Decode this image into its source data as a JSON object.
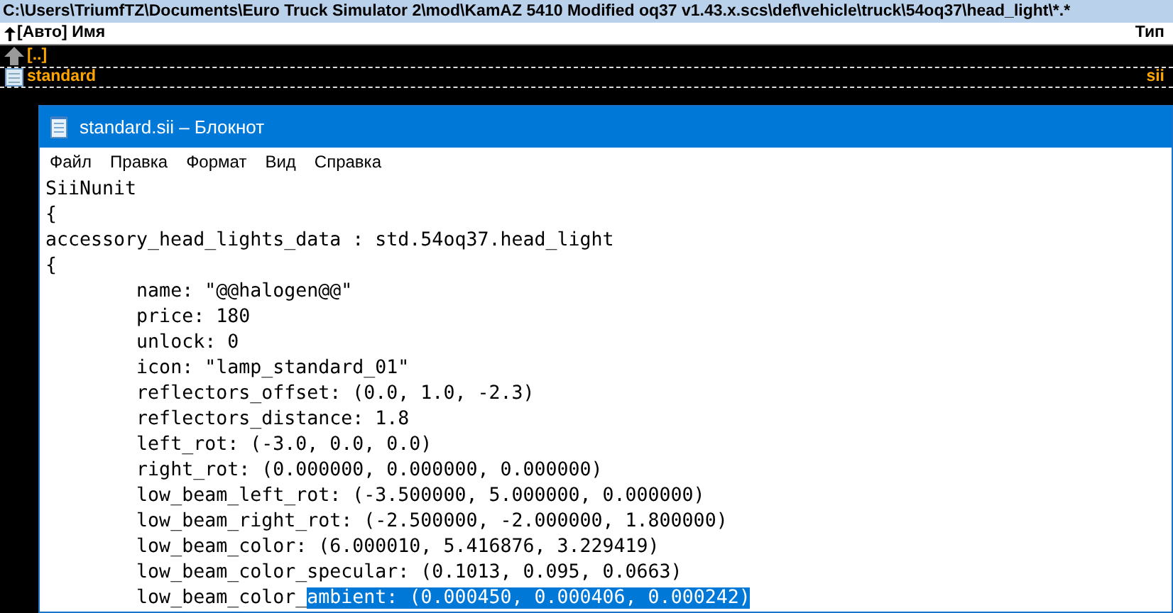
{
  "path_bar": "C:\\Users\\TriumfTZ\\Documents\\Euro Truck Simulator 2\\mod\\KamAZ 5410 Modified oq37 v1.43.x.scs\\def\\vehicle\\truck\\54oq37\\head_light\\*.*",
  "file_panel": {
    "columns": [
      "[Авто] Имя",
      "Тип"
    ],
    "rows": [
      {
        "kind": "parent",
        "name": "[..]",
        "type": "",
        "selected": false
      },
      {
        "kind": "file",
        "name": "standard",
        "type": "sii",
        "selected": true
      }
    ]
  },
  "notepad": {
    "title": "standard.sii – Блокнот",
    "menu": [
      "Файл",
      "Правка",
      "Формат",
      "Вид",
      "Справка"
    ],
    "lines": [
      {
        "text": "SiiNunit"
      },
      {
        "text": "{"
      },
      {
        "text": "accessory_head_lights_data : std.54oq37.head_light"
      },
      {
        "text": "{"
      },
      {
        "text": "\tname: \"@@halogen@@\""
      },
      {
        "text": "\tprice: 180"
      },
      {
        "text": "\tunlock: 0"
      },
      {
        "text": "\ticon: \"lamp_standard_01\""
      },
      {
        "text": "\treflectors_offset: (0.0, 1.0, -2.3)"
      },
      {
        "text": "\treflectors_distance: 1.8"
      },
      {
        "text": "\tleft_rot: (-3.0, 0.0, 0.0)"
      },
      {
        "text": "\tright_rot: (0.000000, 0.000000, 0.000000)"
      },
      {
        "text": "\tlow_beam_left_rot: (-3.500000, 5.000000, 0.000000)"
      },
      {
        "text": "\tlow_beam_right_rot: (-2.500000, -2.000000, 1.800000)"
      },
      {
        "text": "\tlow_beam_color: (6.000010, 5.416876, 3.229419)"
      },
      {
        "text": "\tlow_beam_color_specular: (0.1013, 0.095, 0.0663)"
      },
      {
        "text": "\tlow_beam_color_",
        "selection": "ambient: (0.000450, 0.000406, 0.000242)"
      }
    ]
  }
}
